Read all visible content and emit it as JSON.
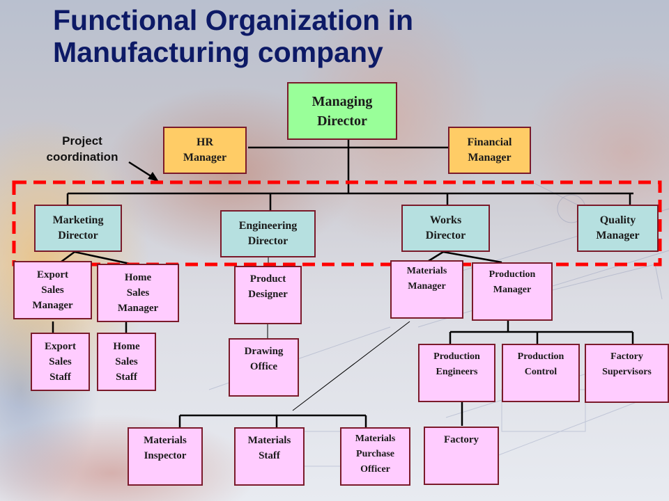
{
  "title": {
    "line1": "Functional Organization in",
    "line2": "Manufacturing company"
  },
  "annotation": {
    "line1": "Project",
    "line2": "coordination",
    "target": "project-coordination-boundary"
  },
  "colors": {
    "title": "#0d1a66",
    "top_level": "#99ff99",
    "staff_advisors": "#ffcc66",
    "directors": "#b6e0e0",
    "sub_units": "#ffccff",
    "box_border": "#7a1a2a",
    "coordination_boundary": "#ff0000"
  },
  "nodes": {
    "md": {
      "lines": [
        "Managing",
        "Director"
      ]
    },
    "hr": {
      "lines": [
        "HR",
        "Manager"
      ]
    },
    "fin": {
      "lines": [
        "Financial",
        "Manager"
      ]
    },
    "mkt": {
      "lines": [
        "Marketing",
        "Director"
      ]
    },
    "eng": {
      "lines": [
        "Engineering",
        "Director"
      ]
    },
    "works": {
      "lines": [
        "Works",
        "Director"
      ]
    },
    "qual": {
      "lines": [
        "Quality",
        "Manager"
      ]
    },
    "esm": {
      "lines": [
        "Export",
        "Sales",
        "Manager"
      ]
    },
    "hsm": {
      "lines": [
        "Home",
        "Sales",
        "Manager"
      ]
    },
    "ess": {
      "lines": [
        "Export",
        "Sales",
        "Staff"
      ]
    },
    "hss": {
      "lines": [
        "Home",
        "Sales",
        "Staff"
      ]
    },
    "pd": {
      "lines": [
        "Product",
        "Designer"
      ]
    },
    "do": {
      "lines": [
        "Drawing",
        "Office"
      ]
    },
    "mm": {
      "lines": [
        "Materials",
        "Manager"
      ]
    },
    "pm": {
      "lines": [
        "Production",
        "Manager"
      ]
    },
    "pe": {
      "lines": [
        "Production",
        "Engineers"
      ]
    },
    "pc": {
      "lines": [
        "Production",
        "Control"
      ]
    },
    "fs": {
      "lines": [
        "Factory",
        "Supervisors"
      ]
    },
    "mi": {
      "lines": [
        "Materials",
        "Inspector"
      ]
    },
    "ms": {
      "lines": [
        "Materials",
        "Staff"
      ]
    },
    "mpo": {
      "lines": [
        "Materials",
        "Purchase",
        "Officer"
      ]
    },
    "fac": {
      "lines": [
        "Factory"
      ]
    }
  },
  "edges": [
    [
      "md",
      "hr"
    ],
    [
      "md",
      "fin"
    ],
    [
      "md",
      "mkt"
    ],
    [
      "md",
      "eng"
    ],
    [
      "md",
      "works"
    ],
    [
      "md",
      "qual"
    ],
    [
      "mkt",
      "esm"
    ],
    [
      "mkt",
      "hsm"
    ],
    [
      "esm",
      "ess"
    ],
    [
      "hsm",
      "hss"
    ],
    [
      "eng",
      "pd"
    ],
    [
      "pd",
      "do"
    ],
    [
      "works",
      "mm"
    ],
    [
      "works",
      "pm"
    ],
    [
      "pm",
      "pe"
    ],
    [
      "pm",
      "pc"
    ],
    [
      "pm",
      "fs"
    ],
    [
      "pe",
      "fac"
    ],
    [
      "mm",
      "mi"
    ],
    [
      "mm",
      "ms"
    ],
    [
      "mm",
      "mpo"
    ]
  ]
}
